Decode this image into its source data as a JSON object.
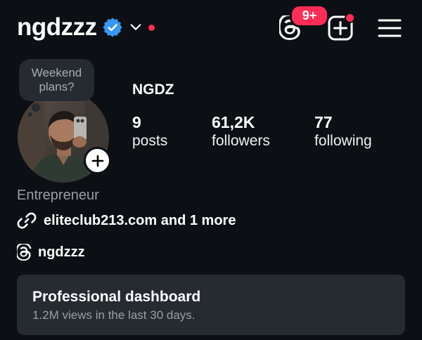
{
  "header": {
    "username": "ngdzzz",
    "notifications_badge": "9+",
    "accent_red": "#ff2d55",
    "verified_blue": "#3897f0"
  },
  "profile": {
    "note_text": "Weekend plans?",
    "display_name": "NGDZ",
    "stats": [
      {
        "value": "9",
        "label": "posts"
      },
      {
        "value": "61,2K",
        "label": "followers"
      },
      {
        "value": "77",
        "label": "following"
      }
    ]
  },
  "bio": {
    "category": "Entrepreneur",
    "link_text": "eliteclub213.com and 1 more",
    "threads_handle": "ngdzzz"
  },
  "dashboard": {
    "title": "Professional dashboard",
    "subtitle": "1.2M views in the last 30 days."
  },
  "icons": {
    "verified": "verified-badge-icon",
    "chevron": "chevron-down-icon",
    "threads": "threads-icon",
    "create": "plus-square-icon",
    "menu": "hamburger-menu-icon",
    "link": "link-icon",
    "add_story": "plus-icon"
  }
}
